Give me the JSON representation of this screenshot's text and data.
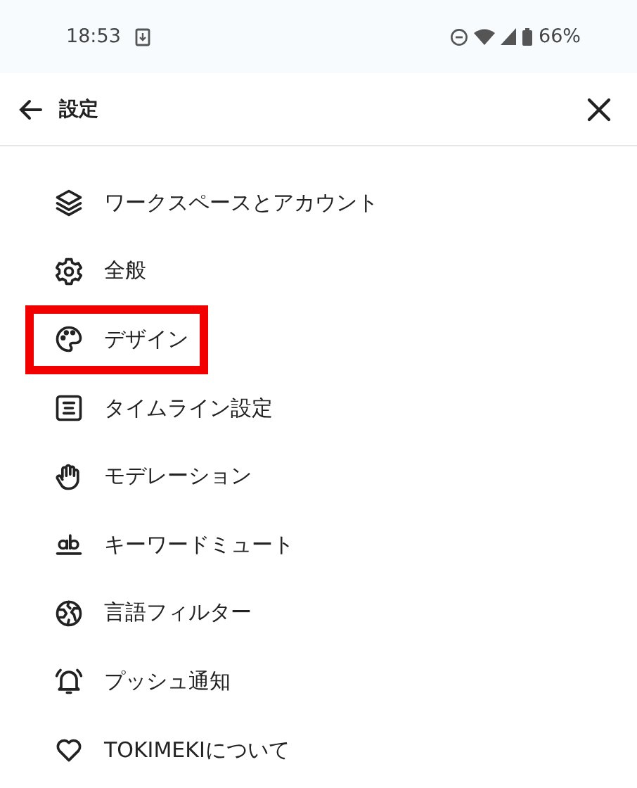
{
  "status_bar": {
    "time": "18:53",
    "battery": "66%"
  },
  "header": {
    "title": "設定"
  },
  "items": [
    {
      "kind": "layers",
      "label": "ワークスペースとアカウント",
      "highlighted": false
    },
    {
      "kind": "gear",
      "label": "全般",
      "highlighted": false
    },
    {
      "kind": "palette",
      "label": "デザイン",
      "highlighted": true
    },
    {
      "kind": "list",
      "label": "タイムライン設定",
      "highlighted": false
    },
    {
      "kind": "hand",
      "label": "モデレーション",
      "highlighted": false
    },
    {
      "kind": "ab",
      "label": "キーワードミュート",
      "highlighted": false
    },
    {
      "kind": "globe",
      "label": "言語フィルター",
      "highlighted": false
    },
    {
      "kind": "bell",
      "label": "プッシュ通知",
      "highlighted": false
    },
    {
      "kind": "heart",
      "label": "TOKIMEKIについて",
      "highlighted": false
    }
  ]
}
